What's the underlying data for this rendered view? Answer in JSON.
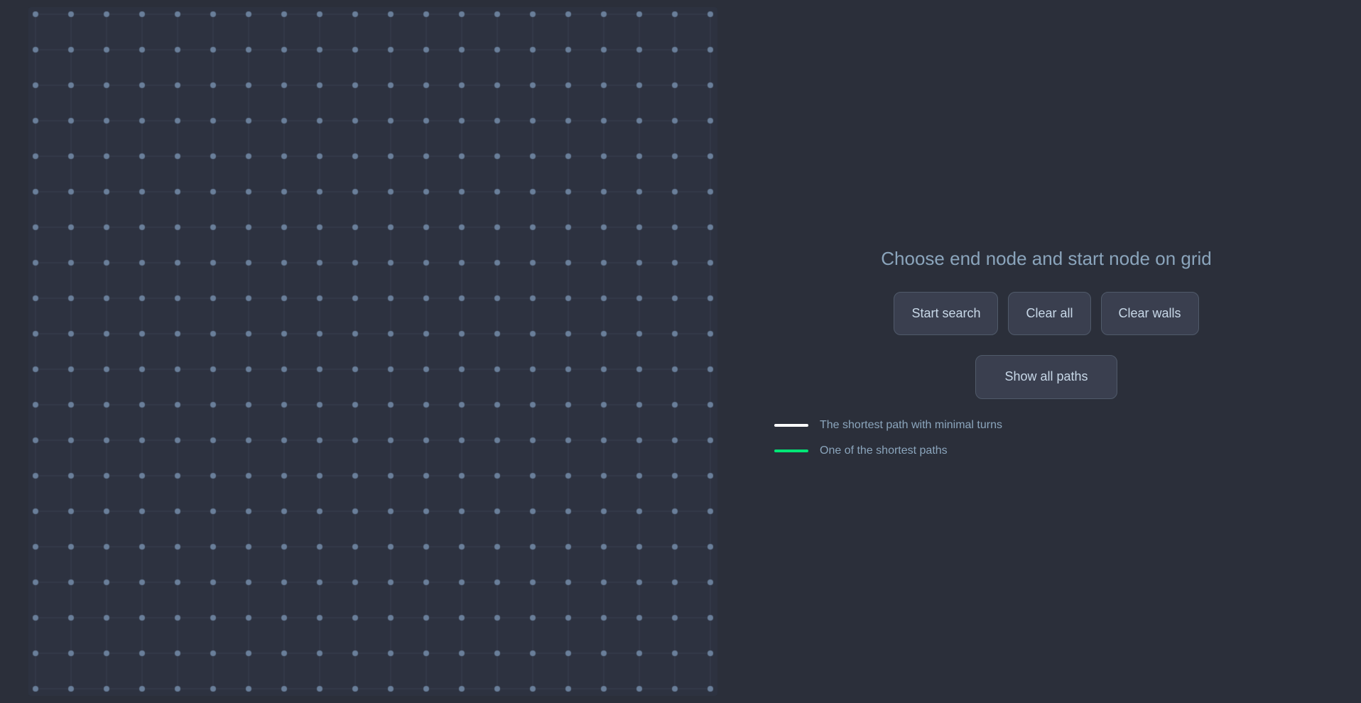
{
  "page": {
    "background": "#2b2f3a",
    "instruction": "Choose end node and start node on grid",
    "buttons": {
      "start_search": "Start search",
      "clear_all": "Clear all",
      "clear_walls": "Clear walls",
      "show_all_paths": "Show all paths"
    },
    "legend": [
      {
        "color": "white",
        "label": "The shortest path with minimal turns"
      },
      {
        "color": "green",
        "label": "One of the shortest paths"
      }
    ],
    "grid": {
      "cols": 19,
      "rows": 19,
      "cell_size": 50,
      "dot_color": "#6a7f9a",
      "line_color": "#3d4455",
      "bg_color": "#2d3240"
    }
  }
}
